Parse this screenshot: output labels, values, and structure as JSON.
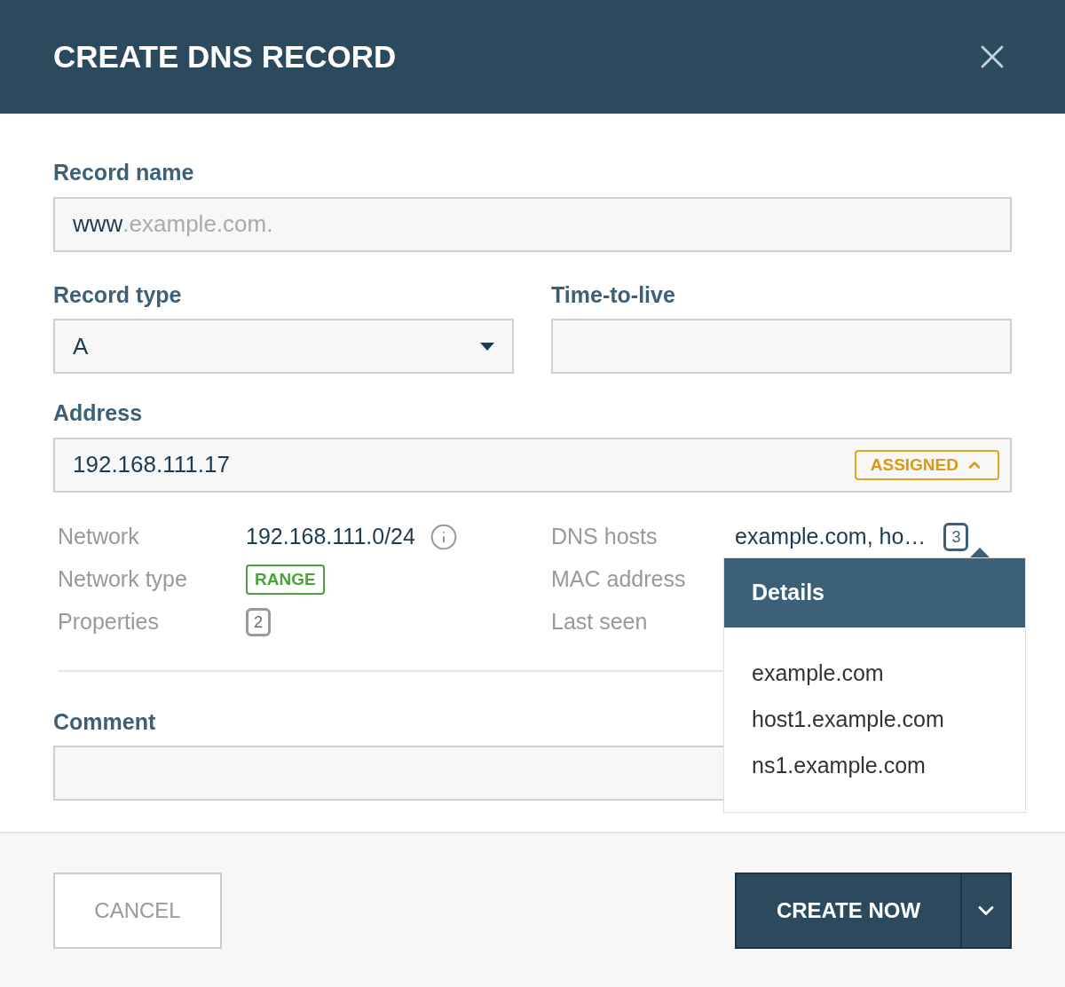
{
  "dialog": {
    "title": "CREATE DNS RECORD"
  },
  "record_name": {
    "label": "Record name",
    "value": "www",
    "suffix": ".example.com."
  },
  "record_type": {
    "label": "Record type",
    "value": "A"
  },
  "ttl": {
    "label": "Time-to-live"
  },
  "address": {
    "label": "Address",
    "value": "192.168.111.17",
    "badge": "ASSIGNED",
    "expanded": true
  },
  "details_left": [
    {
      "label": "Network",
      "kind": "text",
      "value": "192.168.111.0/24"
    },
    {
      "label": "Network type",
      "kind": "tag",
      "value": "RANGE"
    },
    {
      "label": "Properties",
      "kind": "count",
      "value": "2"
    }
  ],
  "details_right": [
    {
      "label": "DNS hosts",
      "kind": "hosts",
      "value": "example.com, ho…",
      "count": "3"
    },
    {
      "label": "MAC address"
    },
    {
      "label": "Last seen"
    }
  ],
  "comment": {
    "label": "Comment"
  },
  "popover": {
    "title": "Details",
    "items": [
      "example.com",
      "host1.example.com",
      "ns1.example.com"
    ]
  },
  "buttons": {
    "cancel": "CANCEL",
    "create": "CREATE NOW"
  }
}
